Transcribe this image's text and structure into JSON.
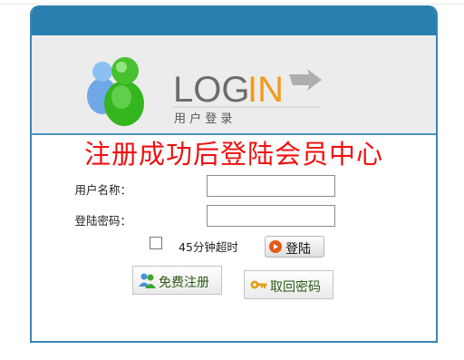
{
  "banner": {
    "logo_word_gray": "LOG",
    "logo_word_orange": "IN",
    "logo_subtitle": "用 户 登 录"
  },
  "notice": "注册成功后登陆会员中心",
  "form": {
    "username_label": "用户名称：",
    "username_value": "",
    "password_label": "登陆密码：",
    "password_value": "",
    "timeout_label": "45分钟超时",
    "timeout_checked": false,
    "login_button": "登陆",
    "register_button": "免费注册",
    "recover_button": "取回密码"
  },
  "colors": {
    "frame_blue": "#2a7fb1",
    "notice_red": "#ee1111",
    "logo_orange": "#f39a1a",
    "button_text_green": "#2f5a14"
  },
  "icons": [
    "users-icon",
    "arrow-icon",
    "play-icon",
    "user-pair-icon",
    "key-icon"
  ]
}
